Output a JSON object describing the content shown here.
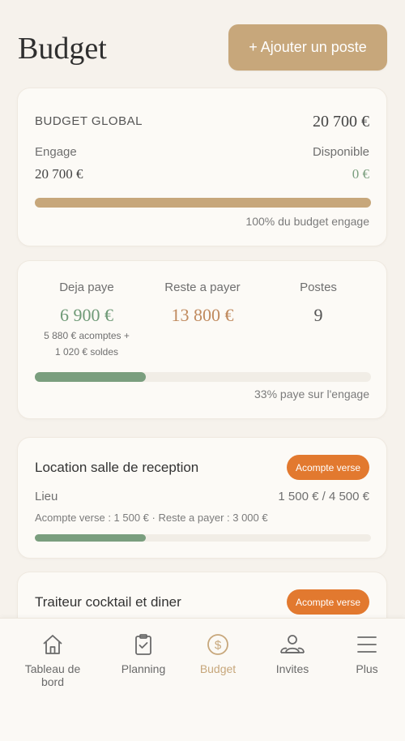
{
  "header": {
    "title": "Budget",
    "add_button": "+ Ajouter un poste"
  },
  "global": {
    "title": "BUDGET GLOBAL",
    "total": "20 700 €",
    "engaged_label": "Engage",
    "engaged_value": "20 700 €",
    "available_label": "Disponible",
    "available_value": "0 €",
    "progress": 1.0,
    "progress_text": "100% du budget engage"
  },
  "payments": {
    "paid_label": "Deja paye",
    "paid_value": "6 900 €",
    "paid_detail_1": "5 880 € acomptes +",
    "paid_detail_2": "1 020 € soldes",
    "remaining_label": "Reste a payer",
    "remaining_value": "13 800 €",
    "items_label": "Postes",
    "items_value": "9",
    "progress": 0.33,
    "progress_text": "33% paye sur l'engage"
  },
  "items": [
    {
      "title": "Location salle de reception",
      "badge": "Acompte verse",
      "category": "Lieu",
      "amounts": "1 500 € / 4 500 €",
      "detail": "Acompte verse : 1 500 € · Reste a payer : 3 000 €",
      "progress": 0.33
    },
    {
      "title": "Traiteur cocktail et diner",
      "badge": "Acompte verse"
    }
  ],
  "nav": {
    "dashboard": "Tableau de bord",
    "planning": "Planning",
    "budget": "Budget",
    "guests": "Invites",
    "more": "Plus"
  },
  "colors": {
    "accent": "#c7a77b",
    "green": "#7a9e7e",
    "orange": "#e2792f",
    "paid_text": "#6f9a77",
    "remaining_text": "#c08a5e"
  }
}
